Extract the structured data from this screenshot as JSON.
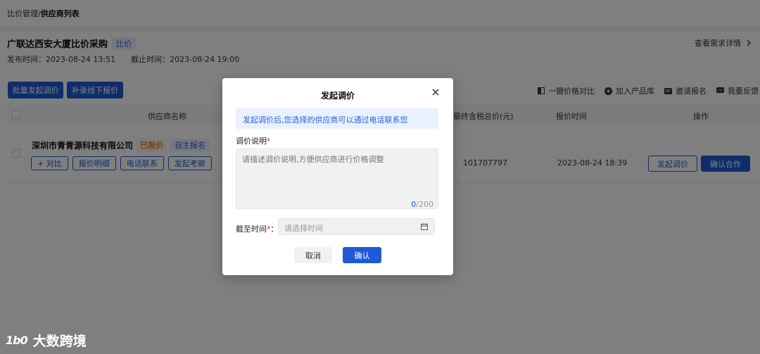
{
  "breadcrumb": {
    "parent": "比价管理",
    "sep": "/",
    "current": "供应商列表"
  },
  "project": {
    "title": "广联达西安大厦比价采购",
    "tag": "比价",
    "publish_time": "发布时间：2023-08-24 13:51",
    "deadline": "截止时间：2023-08-24 19:00",
    "detail_link": "查看需求详情"
  },
  "toolbar": {
    "batch_adjust": "批量发起调价",
    "supplement_offline": "补录线下报价",
    "tools": [
      "一键价格对比",
      "加入产品库",
      "邀请报名",
      "我要反馈"
    ]
  },
  "table": {
    "headers": {
      "supplier": "供应商名称",
      "total": "最终含税总价(元)",
      "time": "报价时间",
      "action": "操作"
    },
    "rows": [
      {
        "supplier": "深圳市青青源科技有限公司",
        "status_tag": "已报价",
        "signup_tag": "自主报名",
        "actions": [
          "+ 对比",
          "报价明细",
          "电话联系",
          "发起考察"
        ],
        "total": "101707797",
        "time": "2023-08-24 18:39",
        "btn_adjust": "发起调价",
        "btn_confirm": "确认合作"
      }
    ]
  },
  "modal": {
    "title": "发起调价",
    "notice": "发起调价后,您选择的供应商可以通过电话联系您",
    "desc_label": "调价说明",
    "required_mark": "*",
    "desc_placeholder": "请描述调价说明,方便供应商进行价格调整",
    "count_current": "0",
    "count_max": "/200",
    "deadline_label": "截至时间",
    "deadline_suffix": "：",
    "deadline_placeholder": "请选择时间",
    "cancel": "取消",
    "confirm": "确认"
  },
  "watermark": {
    "logo": "1b0",
    "text": "大数跨境"
  },
  "colors": {
    "primary": "#1f5ad6",
    "notice_bg": "#e9f1ff",
    "required": "#e0302a"
  }
}
